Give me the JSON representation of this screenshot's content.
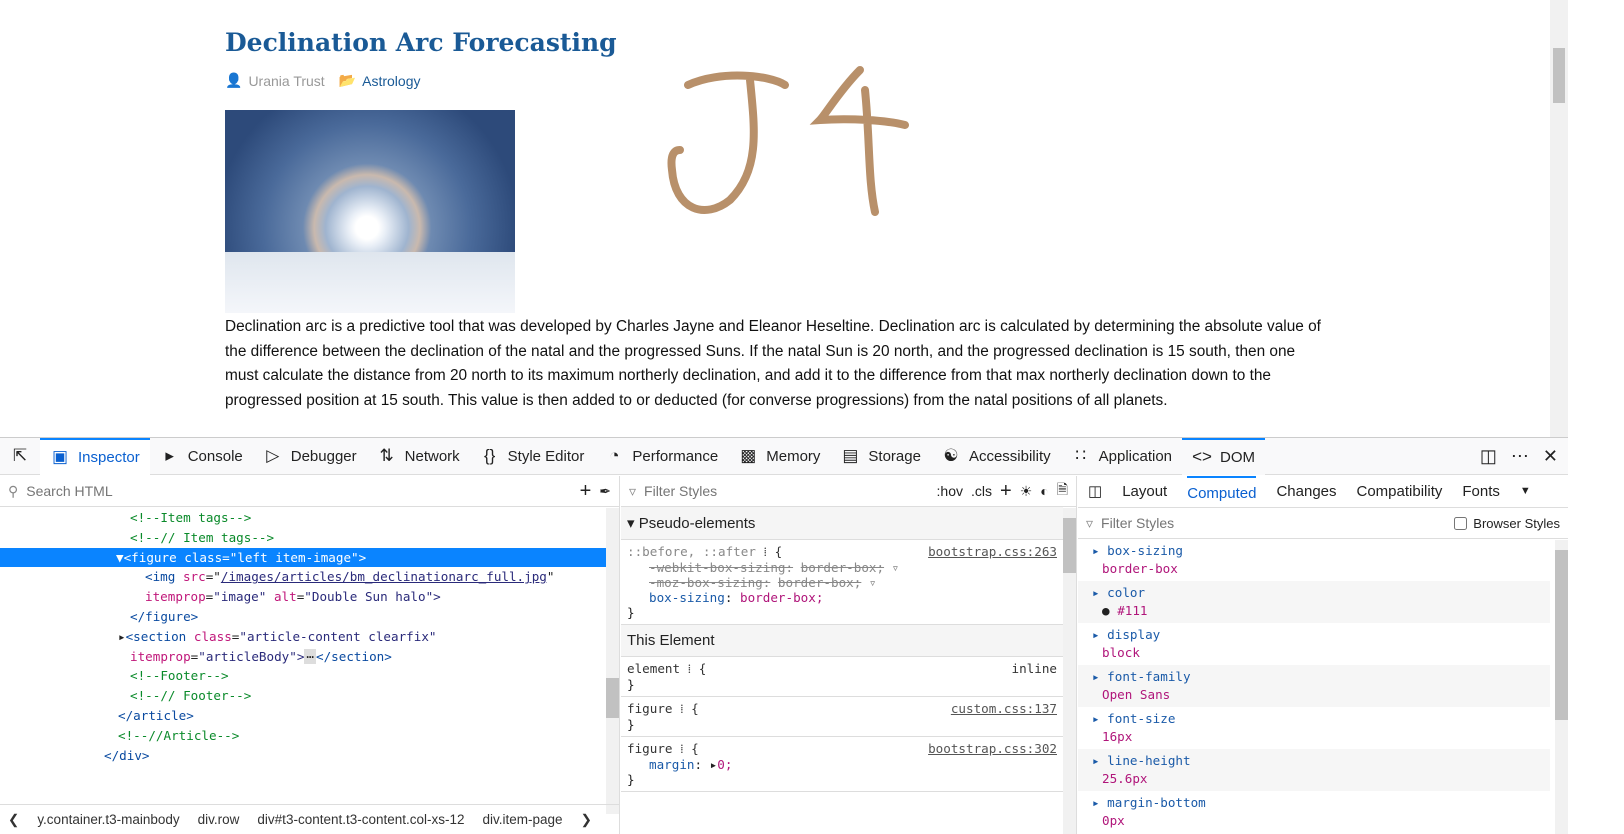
{
  "article": {
    "title": "Declination Arc Forecasting",
    "author": "Urania Trust",
    "category": "Astrology",
    "paragraph": "Declination arc is a predictive tool that was developed by Charles Jayne and Eleanor Heseltine. Declination arc is calculated by determining the absolute value of the difference between the declination of the natal and the progressed Suns. If the natal Sun is 20 north, and the progressed declination is 15 south, then one must calculate the distance from 20 north to its maximum northerly declination, and add it to the difference from that max northerly declination down to the progressed position at 15 south. This value is then added to or deducted (for converse progressions) from the natal positions of all planets.",
    "handwriting": "J4"
  },
  "devtools": {
    "tabs": [
      "Inspector",
      "Console",
      "Debugger",
      "Network",
      "Style Editor",
      "Performance",
      "Memory",
      "Storage",
      "Accessibility",
      "Application",
      "DOM"
    ],
    "search_placeholder": "Search HTML",
    "tree": {
      "r0": "<!--Item tags-->",
      "r1": "<!--// Item tags-->",
      "fig_open": "<figure class=\"left item-image\">",
      "img_tag": "<img",
      "img_src_attr": "src",
      "img_src": "/images/articles/bm_declinationarc_full.jpg",
      "img_itemprop": "itemprop",
      "img_itemprop_val": "\"image\"",
      "img_alt": "alt",
      "img_alt_val": "\"Double Sun halo\">",
      "fig_close": "</figure>",
      "sec_open": "<section",
      "sec_class": "class",
      "sec_class_val": "\"article-content clearfix\"",
      "sec_itemprop": "itemprop",
      "sec_itemprop_val": "\"articleBody\">",
      "sec_close": "</section>",
      "footer": "<!--Footer-->",
      "footer_end": "<!--// Footer-->",
      "article_close": "</article>",
      "article_end": "<!--//Article-->",
      "div_close": "</div>"
    },
    "breadcrumbs": [
      "y.container.t3-mainbody",
      "div.row",
      "div#t3-content.t3-content.col-xs-12",
      "div.item-page"
    ],
    "rules": {
      "filter_placeholder": "Filter Styles",
      "hov": ":hov",
      "cls": ".cls",
      "pseudo_header": "Pseudo-elements",
      "pseudo_selector": "::before, ::after",
      "pseudo_src": "bootstrap.css:263",
      "p1": "-webkit-box-sizing:",
      "p2": "-moz-box-sizing:",
      "pv": "border-box;",
      "p3": "box-sizing",
      "p3v": "border-box;",
      "this_element": "This Element",
      "element_sel": "element",
      "inline": "inline",
      "fig1": "figure",
      "fig1_src": "custom.css:137",
      "fig2": "figure",
      "fig2_src": "bootstrap.css:302",
      "margin": "margin",
      "margin_v": "0;"
    },
    "computed": {
      "tabs": [
        "Layout",
        "Computed",
        "Changes",
        "Compatibility",
        "Fonts"
      ],
      "filter_placeholder": "Filter Styles",
      "browser_styles": "Browser Styles",
      "props": [
        {
          "name": "box-sizing",
          "value": "border-box"
        },
        {
          "name": "color",
          "value": "#111"
        },
        {
          "name": "display",
          "value": "block"
        },
        {
          "name": "font-family",
          "value": "Open Sans"
        },
        {
          "name": "font-size",
          "value": "16px"
        },
        {
          "name": "line-height",
          "value": "25.6px"
        },
        {
          "name": "margin-bottom",
          "value": "0px"
        }
      ]
    }
  }
}
